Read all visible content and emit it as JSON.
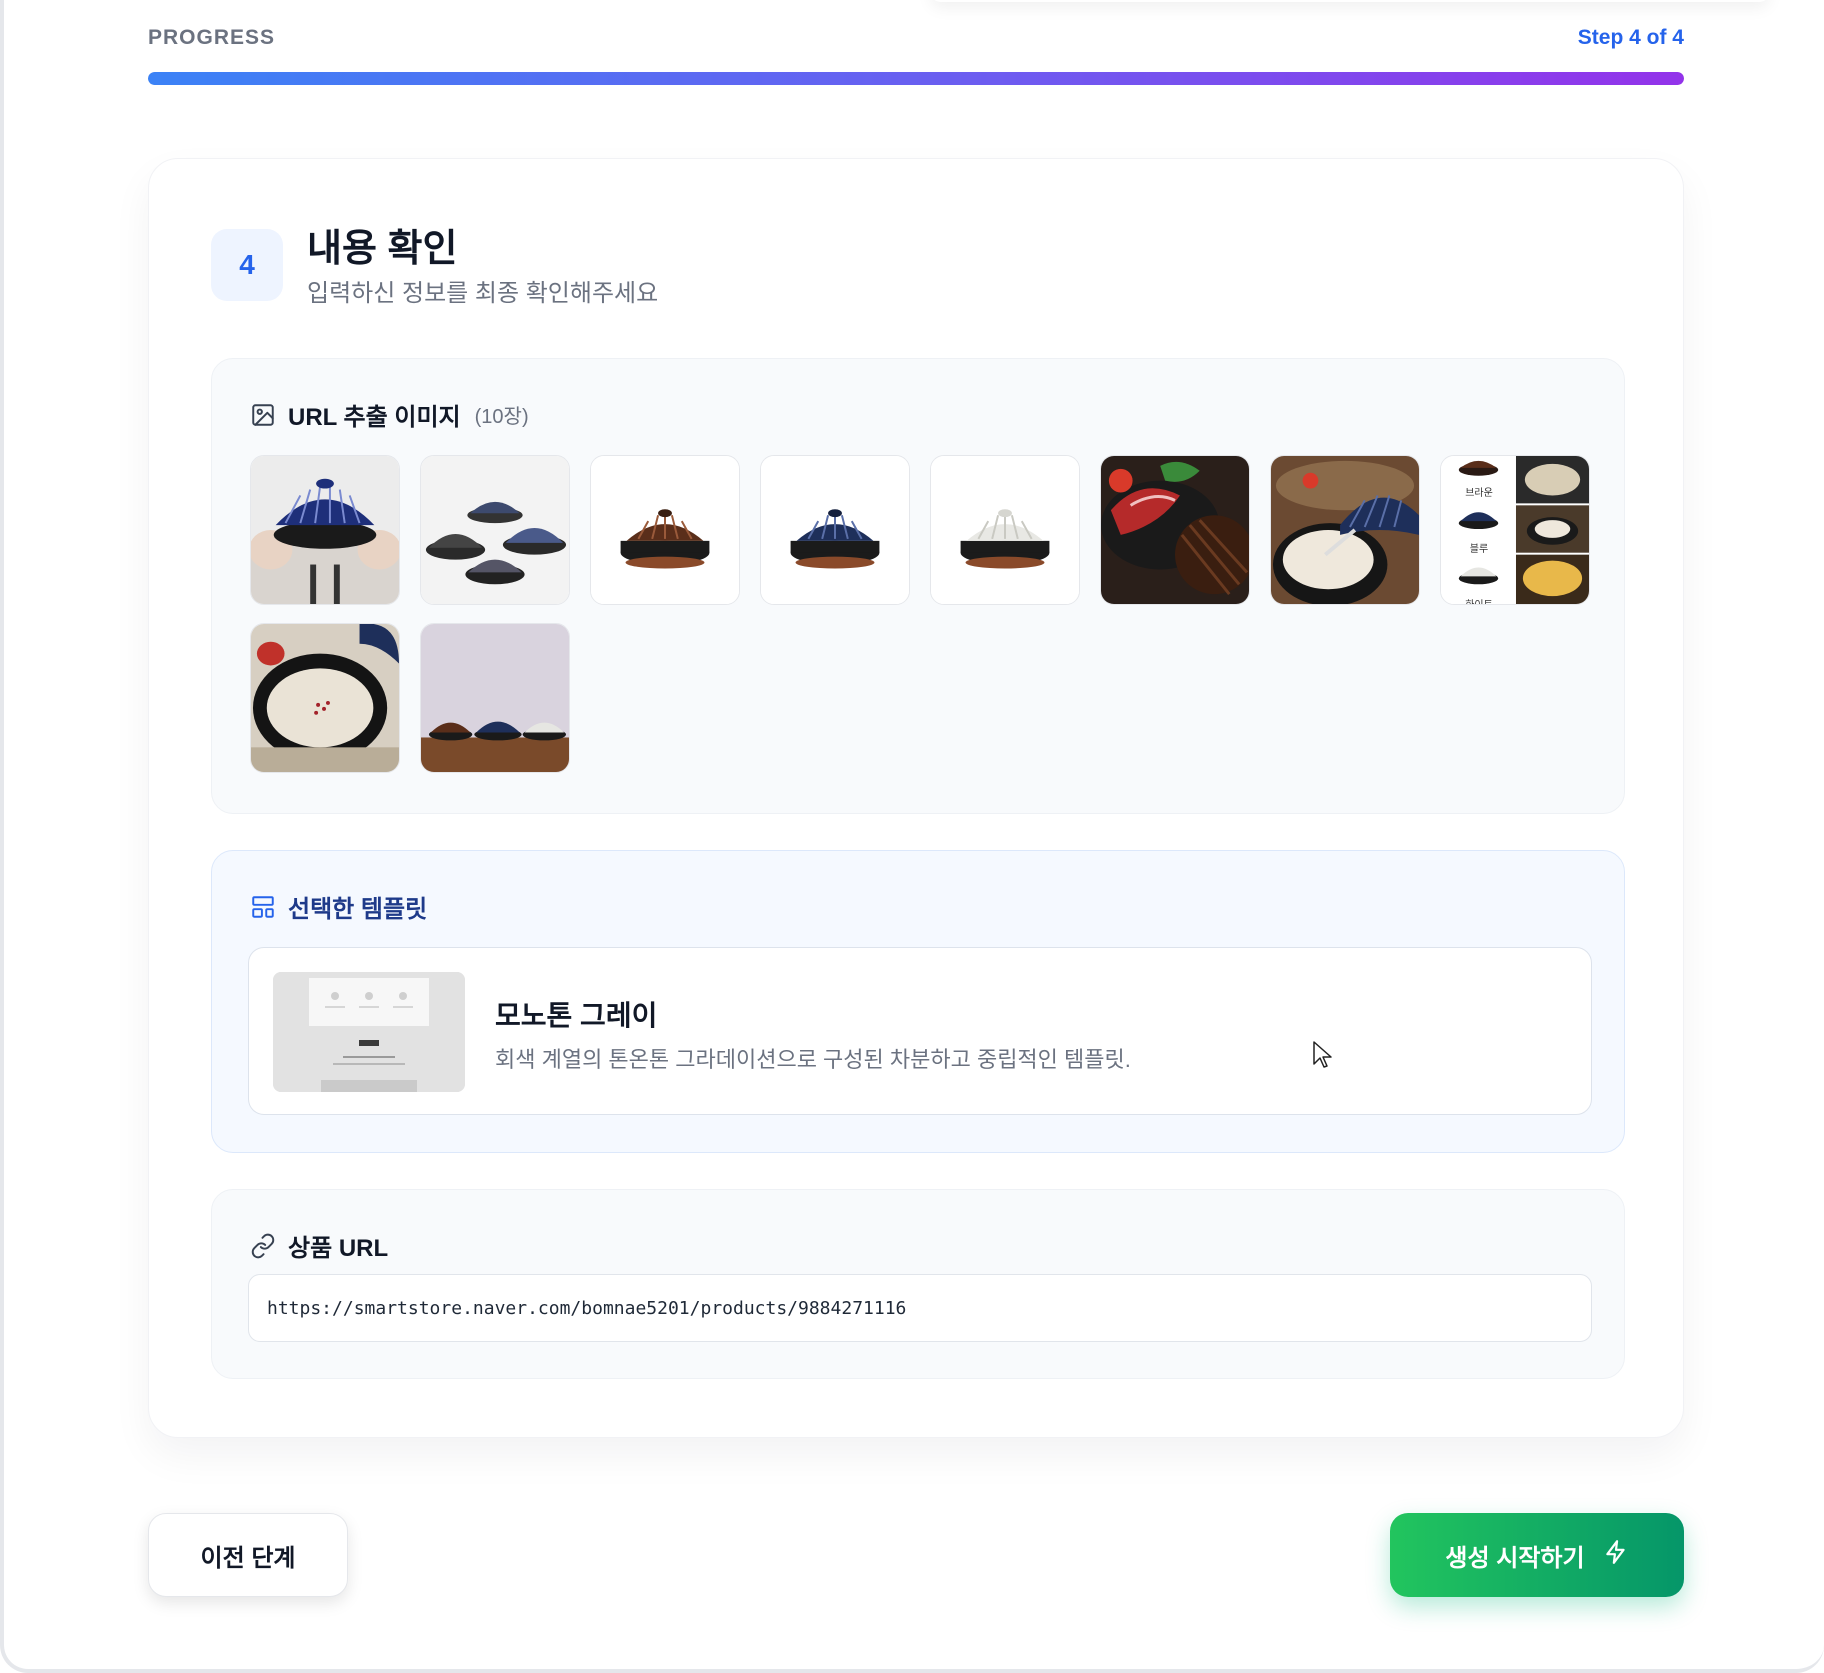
{
  "progress": {
    "label": "PROGRESS",
    "step_text": "Step 4 of 4",
    "fraction": 1.0
  },
  "step": {
    "number": "4",
    "title": "내용 확인",
    "subtitle": "입력하신 정보를 최종 확인해주세요"
  },
  "images_section": {
    "title": "URL 추출 이미지",
    "count": "(10장)",
    "icon": "image-icon",
    "images": [
      {
        "subject": "blue-ribbed-pot-held-in-hands"
      },
      {
        "subject": "group-of-dark-ribbed-pots"
      },
      {
        "subject": "brown-ribbed-pot"
      },
      {
        "subject": "navy-ribbed-pot"
      },
      {
        "subject": "white-ribbed-pot"
      },
      {
        "subject": "pot-with-beef-and-vegetables"
      },
      {
        "subject": "pot-with-cream-soup"
      },
      {
        "subject": "color-variants-collage",
        "labels": [
          "브라운",
          "블루",
          "화이트"
        ]
      },
      {
        "subject": "cream-soup-in-pot-closeup"
      },
      {
        "subject": "three-pots-on-wooden-table"
      }
    ]
  },
  "template_section": {
    "title": "선택한 템플릿",
    "icon": "layout-icon",
    "template_name": "모노톤 그레이",
    "template_description": "회색 계열의 톤온톤 그라데이션으로 구성된 차분하고 중립적인 템플릿."
  },
  "url_section": {
    "title": "상품 URL",
    "icon": "link-icon",
    "url": "https://smartstore.naver.com/bomnae5201/products/9884271116"
  },
  "actions": {
    "prev_label": "이전 단계",
    "start_label": "생성 시작하기",
    "start_icon": "lightning-icon"
  },
  "colors": {
    "accent_blue": "#2563eb",
    "progress_start": "#3b82f6",
    "progress_end": "#9333ea",
    "start_button_from": "#22c55e",
    "start_button_to": "#059669"
  }
}
